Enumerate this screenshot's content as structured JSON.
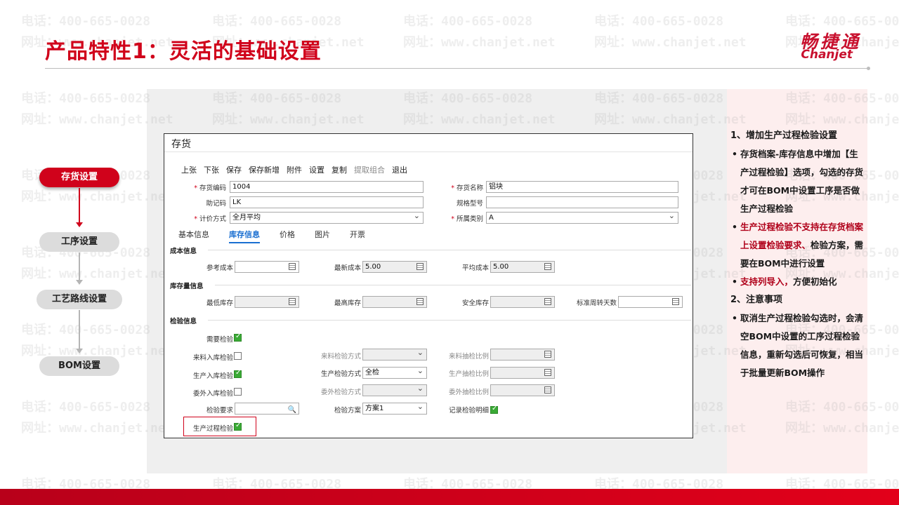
{
  "title": "产品特性1：灵活的基础设置",
  "logo": {
    "cn": "畅捷通",
    "en": "Chanjet"
  },
  "watermark": {
    "phone": "电话：400-665-0028",
    "site": "网址：www.chanjet.net"
  },
  "flow": {
    "step1": "存货设置",
    "step2": "工序设置",
    "step3": "工艺路线设置",
    "step4": "BOM设置"
  },
  "window": {
    "title": "存货",
    "toolbar": [
      "上张",
      "下张",
      "保存",
      "保存新增",
      "附件",
      "设置",
      "复制",
      "提取组合",
      "退出"
    ],
    "fields": {
      "code_label": "存货编码",
      "code_value": "1004",
      "name_label": "存货名称",
      "name_value": "铝块",
      "mnemonic_label": "助记码",
      "mnemonic_value": "LK",
      "spec_label": "规格型号",
      "spec_value": "",
      "cost_method_label": "计价方式",
      "cost_method_value": "全月平均",
      "category_label": "所属类别",
      "category_value": "A"
    },
    "tabs": [
      "基本信息",
      "库存信息",
      "价格",
      "图片",
      "开票"
    ],
    "cost": {
      "section": "成本信息",
      "ref_label": "参考成本",
      "ref_value": "",
      "latest_label": "最新成本",
      "latest_value": "5.00",
      "avg_label": "平均成本",
      "avg_value": "5.00"
    },
    "stock": {
      "section": "库存量信息",
      "min_label": "最低库存",
      "max_label": "最高库存",
      "safe_label": "安全库存",
      "turnover_label": "标准周转天数"
    },
    "inspection": {
      "section": "检验信息",
      "need_label": "需要检验",
      "incoming_label": "来料入库检验",
      "incoming_method_label": "来料检验方式",
      "incoming_ratio_label": "来料抽检比例",
      "production_in_label": "生产入库检验",
      "production_method_label": "生产检验方式",
      "production_method_value": "全检",
      "production_ratio_label": "生产抽检比例",
      "outsource_label": "委外入库检验",
      "outsource_method_label": "委外检验方式",
      "outsource_ratio_label": "委外抽检比例",
      "requirement_label": "检验要求",
      "plan_label": "检验方案",
      "plan_value": "方案1",
      "record_detail_label": "记录检验明细",
      "process_label": "生产过程检验"
    }
  },
  "notes": {
    "h1": "1、增加生产过程检验设置",
    "b1": "存货档案-库存信息中增加【生产过程检验】选项，勾选的存货才可在BOM中设置工序是否做生产过程检验",
    "b2_red": "生产过程检验不支持在存货档案上设置检验要求、",
    "b2_rest": "检验方案，需要在BOM中进行设置",
    "b3_red": "支持列导入，",
    "b3_rest": "方便初始化",
    "h2": "2、注意事项",
    "b4": "取消生产过程检验勾选时，会清空BOM中设置的工序过程检验信息，重新勾选后可恢复，相当于批量更新BOM操作"
  },
  "colors": {
    "brand_red": "#d0021b",
    "tab_blue": "#1a6fd1",
    "check_green": "#3aaa35"
  }
}
